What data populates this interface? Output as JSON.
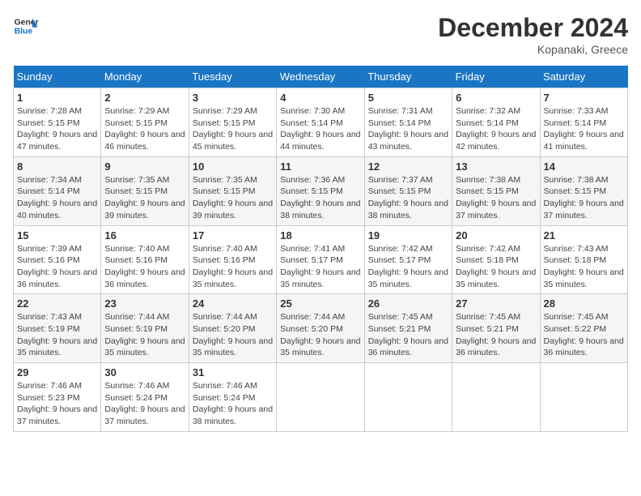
{
  "header": {
    "logo_line1": "General",
    "logo_line2": "Blue",
    "month_year": "December 2024",
    "location": "Kopanaki, Greece"
  },
  "days_of_week": [
    "Sunday",
    "Monday",
    "Tuesday",
    "Wednesday",
    "Thursday",
    "Friday",
    "Saturday"
  ],
  "weeks": [
    [
      {
        "day": "1",
        "sunrise": "7:28 AM",
        "sunset": "5:15 PM",
        "daylight": "9 hours and 47 minutes."
      },
      {
        "day": "2",
        "sunrise": "7:29 AM",
        "sunset": "5:15 PM",
        "daylight": "9 hours and 46 minutes."
      },
      {
        "day": "3",
        "sunrise": "7:29 AM",
        "sunset": "5:15 PM",
        "daylight": "9 hours and 45 minutes."
      },
      {
        "day": "4",
        "sunrise": "7:30 AM",
        "sunset": "5:14 PM",
        "daylight": "9 hours and 44 minutes."
      },
      {
        "day": "5",
        "sunrise": "7:31 AM",
        "sunset": "5:14 PM",
        "daylight": "9 hours and 43 minutes."
      },
      {
        "day": "6",
        "sunrise": "7:32 AM",
        "sunset": "5:14 PM",
        "daylight": "9 hours and 42 minutes."
      },
      {
        "day": "7",
        "sunrise": "7:33 AM",
        "sunset": "5:14 PM",
        "daylight": "9 hours and 41 minutes."
      }
    ],
    [
      {
        "day": "8",
        "sunrise": "7:34 AM",
        "sunset": "5:14 PM",
        "daylight": "9 hours and 40 minutes."
      },
      {
        "day": "9",
        "sunrise": "7:35 AM",
        "sunset": "5:15 PM",
        "daylight": "9 hours and 39 minutes."
      },
      {
        "day": "10",
        "sunrise": "7:35 AM",
        "sunset": "5:15 PM",
        "daylight": "9 hours and 39 minutes."
      },
      {
        "day": "11",
        "sunrise": "7:36 AM",
        "sunset": "5:15 PM",
        "daylight": "9 hours and 38 minutes."
      },
      {
        "day": "12",
        "sunrise": "7:37 AM",
        "sunset": "5:15 PM",
        "daylight": "9 hours and 38 minutes."
      },
      {
        "day": "13",
        "sunrise": "7:38 AM",
        "sunset": "5:15 PM",
        "daylight": "9 hours and 37 minutes."
      },
      {
        "day": "14",
        "sunrise": "7:38 AM",
        "sunset": "5:15 PM",
        "daylight": "9 hours and 37 minutes."
      }
    ],
    [
      {
        "day": "15",
        "sunrise": "7:39 AM",
        "sunset": "5:16 PM",
        "daylight": "9 hours and 36 minutes."
      },
      {
        "day": "16",
        "sunrise": "7:40 AM",
        "sunset": "5:16 PM",
        "daylight": "9 hours and 36 minutes."
      },
      {
        "day": "17",
        "sunrise": "7:40 AM",
        "sunset": "5:16 PM",
        "daylight": "9 hours and 35 minutes."
      },
      {
        "day": "18",
        "sunrise": "7:41 AM",
        "sunset": "5:17 PM",
        "daylight": "9 hours and 35 minutes."
      },
      {
        "day": "19",
        "sunrise": "7:42 AM",
        "sunset": "5:17 PM",
        "daylight": "9 hours and 35 minutes."
      },
      {
        "day": "20",
        "sunrise": "7:42 AM",
        "sunset": "5:18 PM",
        "daylight": "9 hours and 35 minutes."
      },
      {
        "day": "21",
        "sunrise": "7:43 AM",
        "sunset": "5:18 PM",
        "daylight": "9 hours and 35 minutes."
      }
    ],
    [
      {
        "day": "22",
        "sunrise": "7:43 AM",
        "sunset": "5:19 PM",
        "daylight": "9 hours and 35 minutes."
      },
      {
        "day": "23",
        "sunrise": "7:44 AM",
        "sunset": "5:19 PM",
        "daylight": "9 hours and 35 minutes."
      },
      {
        "day": "24",
        "sunrise": "7:44 AM",
        "sunset": "5:20 PM",
        "daylight": "9 hours and 35 minutes."
      },
      {
        "day": "25",
        "sunrise": "7:44 AM",
        "sunset": "5:20 PM",
        "daylight": "9 hours and 35 minutes."
      },
      {
        "day": "26",
        "sunrise": "7:45 AM",
        "sunset": "5:21 PM",
        "daylight": "9 hours and 36 minutes."
      },
      {
        "day": "27",
        "sunrise": "7:45 AM",
        "sunset": "5:21 PM",
        "daylight": "9 hours and 36 minutes."
      },
      {
        "day": "28",
        "sunrise": "7:45 AM",
        "sunset": "5:22 PM",
        "daylight": "9 hours and 36 minutes."
      }
    ],
    [
      {
        "day": "29",
        "sunrise": "7:46 AM",
        "sunset": "5:23 PM",
        "daylight": "9 hours and 37 minutes."
      },
      {
        "day": "30",
        "sunrise": "7:46 AM",
        "sunset": "5:24 PM",
        "daylight": "9 hours and 37 minutes."
      },
      {
        "day": "31",
        "sunrise": "7:46 AM",
        "sunset": "5:24 PM",
        "daylight": "9 hours and 38 minutes."
      },
      null,
      null,
      null,
      null
    ]
  ]
}
